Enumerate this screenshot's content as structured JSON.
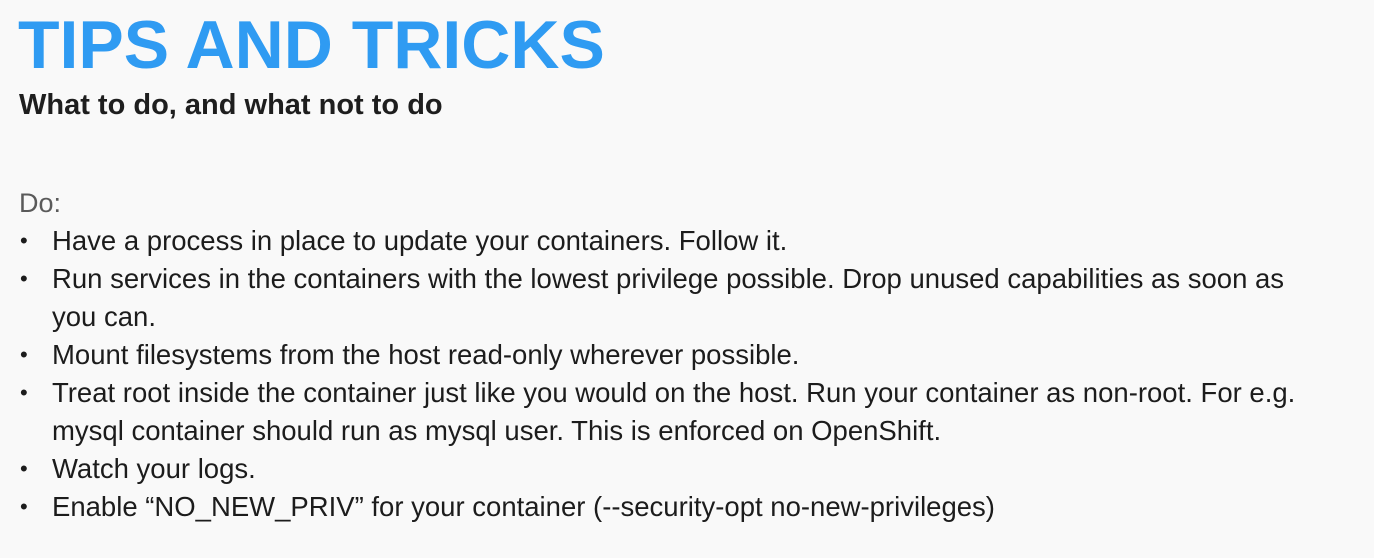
{
  "slide": {
    "title": "TIPS AND TRICKS",
    "subtitle": "What to do, and what not to do",
    "section_label": "Do:",
    "bullets": [
      "Have a process in place to update your containers. Follow it.",
      "Run services in the containers with the lowest privilege possible. Drop unused capabilities as soon as you can.",
      "Mount filesystems from the host read-only wherever possible.",
      "Treat root inside the container just like you would on the host. Run your container as non-root. For e.g. mysql container should run as mysql user. This is enforced on OpenShift.",
      "Watch your logs.",
      "Enable “NO_NEW_PRIV” for your container (--security-opt no-new-privileges)"
    ],
    "bullet_symbol": "•"
  },
  "colors": {
    "title": "#2f9bf2",
    "subtitle": "#1e1e1e",
    "section_label": "#5a5a5a",
    "body_text": "#1c1c1c",
    "background": "#f9f9f9"
  }
}
